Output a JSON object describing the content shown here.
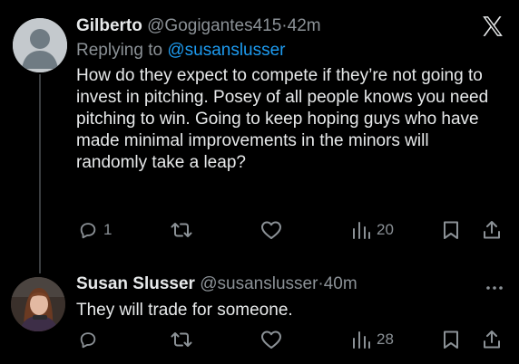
{
  "tweet1": {
    "name": "Gilberto",
    "handle": "@Gogigantes415",
    "dot": "·",
    "time": "42m",
    "replying_prefix": "Replying to ",
    "replying_to": "@susanslusser",
    "body": "How do they expect to compete if they’re not going to invest in pitching. Posey of all people knows you need pitching to win. Going to keep hoping guys who have made minimal improvements in the minors will randomly take a leap?",
    "reply_count": "1",
    "views": "20"
  },
  "tweet2": {
    "name": "Susan Slusser",
    "handle": "@susanslusser",
    "dot": "·",
    "time": "40m",
    "body": "They will trade for someone.",
    "views": "28"
  },
  "colors": {
    "background": "#000000",
    "text": "#e7e9ea",
    "secondary": "#8b9196",
    "link": "#1d9bf0"
  },
  "icons": [
    "x-logo-icon",
    "reply-icon",
    "retweet-icon",
    "like-icon",
    "views-icon",
    "bookmark-icon",
    "share-icon",
    "more-icon"
  ]
}
